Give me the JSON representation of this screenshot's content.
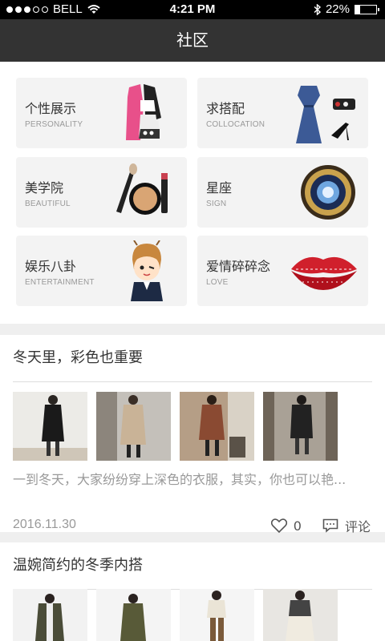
{
  "status_bar": {
    "carrier": "BELL",
    "time": "4:21 PM",
    "battery": "22%",
    "battery_level": 0.22
  },
  "header": {
    "title": "社区"
  },
  "categories": [
    {
      "zh": "个性展示",
      "en": "PERSONALITY",
      "icon": "coat-icon"
    },
    {
      "zh": "求搭配",
      "en": "COLLOCATION",
      "icon": "dress-icon"
    },
    {
      "zh": "美学院",
      "en": "BEAUTIFUL",
      "icon": "makeup-icon"
    },
    {
      "zh": "星座",
      "en": "SIGN",
      "icon": "zodiac-icon"
    },
    {
      "zh": "娱乐八卦",
      "en": "ENTERTAINMENT",
      "icon": "cartoon-boy-icon"
    },
    {
      "zh": "爱情碎碎念",
      "en": "LOVE",
      "icon": "lips-icon"
    }
  ],
  "articles": [
    {
      "title": "冬天里，彩色也重要",
      "description": "一到冬天，大家纷纷穿上深色的衣服，其实，你也可以艳...",
      "date": "2016.11.30",
      "likes": "0",
      "comment_label": "评论",
      "photo_colors": [
        "#1a1a1a",
        "#c9b397",
        "#8a4a32",
        "#222222"
      ]
    },
    {
      "title": "温婉简约的冬季内搭",
      "photo_colors": [
        "#4a4c38",
        "#585a38",
        "#7a5a3a",
        "#444444"
      ]
    }
  ]
}
